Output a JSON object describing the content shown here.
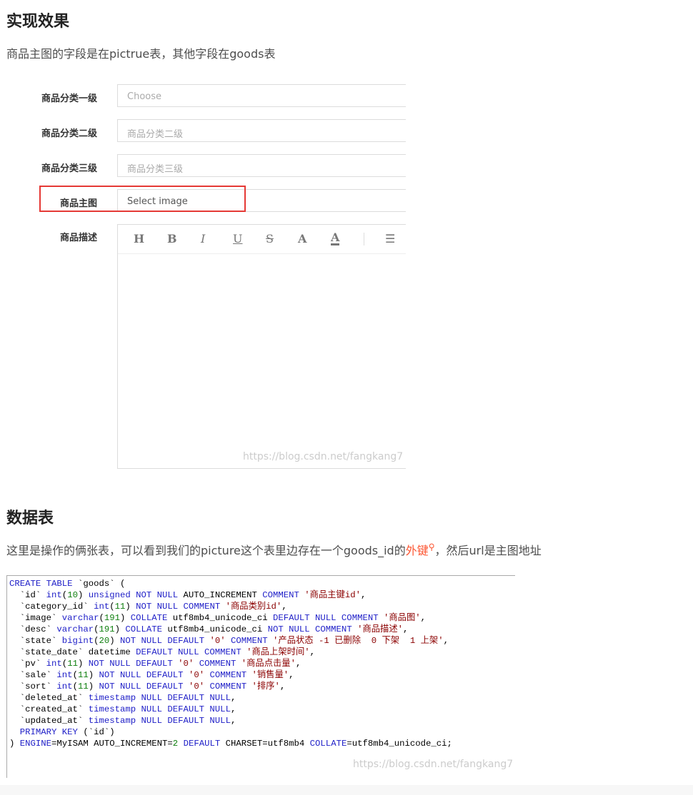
{
  "section1": {
    "title": "实现效果",
    "desc": "商品主图的字段是在pictrue表，其他字段在goods表"
  },
  "form": {
    "fields": [
      {
        "label": "商品分类一级",
        "placeholder": "Choose"
      },
      {
        "label": "商品分类二级",
        "placeholder": "商品分类二级"
      },
      {
        "label": "商品分类三级",
        "placeholder": "商品分类三级"
      },
      {
        "label": "商品主图",
        "value": "Select image"
      }
    ],
    "desc_label": "商品描述",
    "toolbar": [
      {
        "glyph": "H",
        "icon": "heading-icon"
      },
      {
        "glyph": "B",
        "icon": "bold-icon"
      },
      {
        "glyph": "I",
        "icon": "italic-icon"
      },
      {
        "glyph": "U",
        "icon": "underline-icon"
      },
      {
        "glyph": "S",
        "icon": "strikethrough-icon"
      },
      {
        "glyph": "A",
        "icon": "font-color-icon"
      },
      {
        "glyph": "A",
        "icon": "background-color-icon"
      },
      {
        "glyph": "☰",
        "icon": "ordered-list-icon"
      }
    ],
    "highlight_color": "#e53935"
  },
  "watermark": "https://blog.csdn.net/fangkang7",
  "section2": {
    "title": "数据表",
    "desc_before": "这里是操作的俩张表，可以看到我们的picture这个表里边存在一个goods_id的",
    "link": "外键",
    "desc_after": "，然后url是主图地址"
  },
  "colors": {
    "keyword": "#2020c8",
    "number": "#108010",
    "string": "#8b0000",
    "link": "#fc5531"
  },
  "code": [
    [
      [
        "k",
        "CREATE TABLE"
      ],
      [
        "t",
        " `goods` ("
      ]
    ],
    [
      [
        "t",
        "  `id` "
      ],
      [
        "k",
        "int"
      ],
      [
        "t",
        "("
      ],
      [
        "n",
        "10"
      ],
      [
        "t",
        ") "
      ],
      [
        "k",
        "unsigned NOT NULL"
      ],
      [
        "t",
        " AUTO_INCREMENT "
      ],
      [
        "k",
        "COMMENT"
      ],
      [
        "s",
        " '商品主键id'"
      ],
      [
        "t",
        ","
      ]
    ],
    [
      [
        "t",
        "  `category_id` "
      ],
      [
        "k",
        "int"
      ],
      [
        "t",
        "("
      ],
      [
        "n",
        "11"
      ],
      [
        "t",
        ") "
      ],
      [
        "k",
        "NOT NULL COMMENT"
      ],
      [
        "s",
        " '商品类别id'"
      ],
      [
        "t",
        ","
      ]
    ],
    [
      [
        "t",
        "  `image` "
      ],
      [
        "k",
        "varchar"
      ],
      [
        "t",
        "("
      ],
      [
        "n",
        "191"
      ],
      [
        "t",
        ") "
      ],
      [
        "k",
        "COLLATE"
      ],
      [
        "t",
        " utf8mb4_unicode_ci "
      ],
      [
        "k",
        "DEFAULT NULL COMMENT"
      ],
      [
        "s",
        " '商品图'"
      ],
      [
        "t",
        ","
      ]
    ],
    [
      [
        "t",
        "  `desc` "
      ],
      [
        "k",
        "varchar"
      ],
      [
        "t",
        "("
      ],
      [
        "n",
        "191"
      ],
      [
        "t",
        ") "
      ],
      [
        "k",
        "COLLATE"
      ],
      [
        "t",
        " utf8mb4_unicode_ci "
      ],
      [
        "k",
        "NOT NULL COMMENT"
      ],
      [
        "s",
        " '商品描述'"
      ],
      [
        "t",
        ","
      ]
    ],
    [
      [
        "t",
        "  `state` "
      ],
      [
        "k",
        "bigint"
      ],
      [
        "t",
        "("
      ],
      [
        "n",
        "20"
      ],
      [
        "t",
        ") "
      ],
      [
        "k",
        "NOT NULL DEFAULT"
      ],
      [
        "s",
        " '0' "
      ],
      [
        "k",
        "COMMENT"
      ],
      [
        "s",
        " '产品状态 -1 已删除  0 下架  1 上架'"
      ],
      [
        "t",
        ","
      ]
    ],
    [
      [
        "t",
        "  `state_date` datetime "
      ],
      [
        "k",
        "DEFAULT NULL COMMENT"
      ],
      [
        "s",
        " '商品上架时间'"
      ],
      [
        "t",
        ","
      ]
    ],
    [
      [
        "t",
        "  `pv` "
      ],
      [
        "k",
        "int"
      ],
      [
        "t",
        "("
      ],
      [
        "n",
        "11"
      ],
      [
        "t",
        ") "
      ],
      [
        "k",
        "NOT NULL DEFAULT"
      ],
      [
        "s",
        " '0' "
      ],
      [
        "k",
        "COMMENT"
      ],
      [
        "s",
        " '商品点击量'"
      ],
      [
        "t",
        ","
      ]
    ],
    [
      [
        "t",
        "  `sale` "
      ],
      [
        "k",
        "int"
      ],
      [
        "t",
        "("
      ],
      [
        "n",
        "11"
      ],
      [
        "t",
        ") "
      ],
      [
        "k",
        "NOT NULL DEFAULT"
      ],
      [
        "s",
        " '0' "
      ],
      [
        "k",
        "COMMENT"
      ],
      [
        "s",
        " '销售量'"
      ],
      [
        "t",
        ","
      ]
    ],
    [
      [
        "t",
        "  `sort` "
      ],
      [
        "k",
        "int"
      ],
      [
        "t",
        "("
      ],
      [
        "n",
        "11"
      ],
      [
        "t",
        ") "
      ],
      [
        "k",
        "NOT NULL DEFAULT"
      ],
      [
        "s",
        " '0' "
      ],
      [
        "k",
        "COMMENT"
      ],
      [
        "s",
        " '排序'"
      ],
      [
        "t",
        ","
      ]
    ],
    [
      [
        "t",
        "  `deleted_at` "
      ],
      [
        "k",
        "timestamp NULL DEFAULT NULL"
      ],
      [
        "t",
        ","
      ]
    ],
    [
      [
        "t",
        "  `created_at` "
      ],
      [
        "k",
        "timestamp NULL DEFAULT NULL"
      ],
      [
        "t",
        ","
      ]
    ],
    [
      [
        "t",
        "  `updated_at` "
      ],
      [
        "k",
        "timestamp NULL DEFAULT NULL"
      ],
      [
        "t",
        ","
      ]
    ],
    [
      [
        "t",
        "  "
      ],
      [
        "k",
        "PRIMARY KEY"
      ],
      [
        "t",
        " (`id`)"
      ]
    ],
    [
      [
        "t",
        ") "
      ],
      [
        "k",
        "ENGINE"
      ],
      [
        "t",
        "=MyISAM AUTO_INCREMENT="
      ],
      [
        "n",
        "2"
      ],
      [
        "t",
        " "
      ],
      [
        "k",
        "DEFAULT"
      ],
      [
        "t",
        " CHARSET=utf8mb4 "
      ],
      [
        "k",
        "COLLATE"
      ],
      [
        "t",
        "=utf8mb4_unicode_ci;"
      ]
    ]
  ]
}
